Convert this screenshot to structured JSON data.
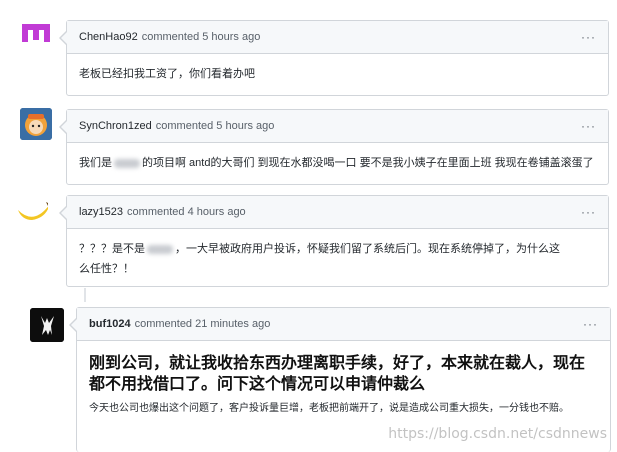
{
  "comments": [
    {
      "author": "ChenHao92",
      "meta": "commented 5 hours ago",
      "more": "···",
      "body": "老板已经扣我工资了，你们看着办吧"
    },
    {
      "author": "SynChron1zed",
      "meta": "commented 5 hours ago",
      "more": "···",
      "body_pre": "我们是",
      "body_post": "的项目啊 antd的大哥们 到现在水都没喝一口 要不是我小姨子在里面上班 我现在卷铺盖滚蛋了"
    },
    {
      "author": "lazy1523",
      "meta": "commented 4 hours ago",
      "more": "···",
      "body_pre": "？？？是不是",
      "body_post": "，一大早被政府用户投诉，怀疑我们留了系统后门。现在系统停掉了，为什么这么任性？！"
    },
    {
      "author": "buf1024",
      "meta": "commented 21 minutes ago",
      "more": "···",
      "headline": "刚到公司，就让我收拾东西办理离职手续，好了，本来就在裁人，现在都不用找借口了。问下这个情况可以申请仲裁么",
      "body": "今天也公司也爆出这个问题了，客户投诉量巨增，老板把前端开了，说是造成公司重大损失，一分钱也不赔。"
    }
  ],
  "watermark": "https://blog.csdn.net/csdnnews"
}
